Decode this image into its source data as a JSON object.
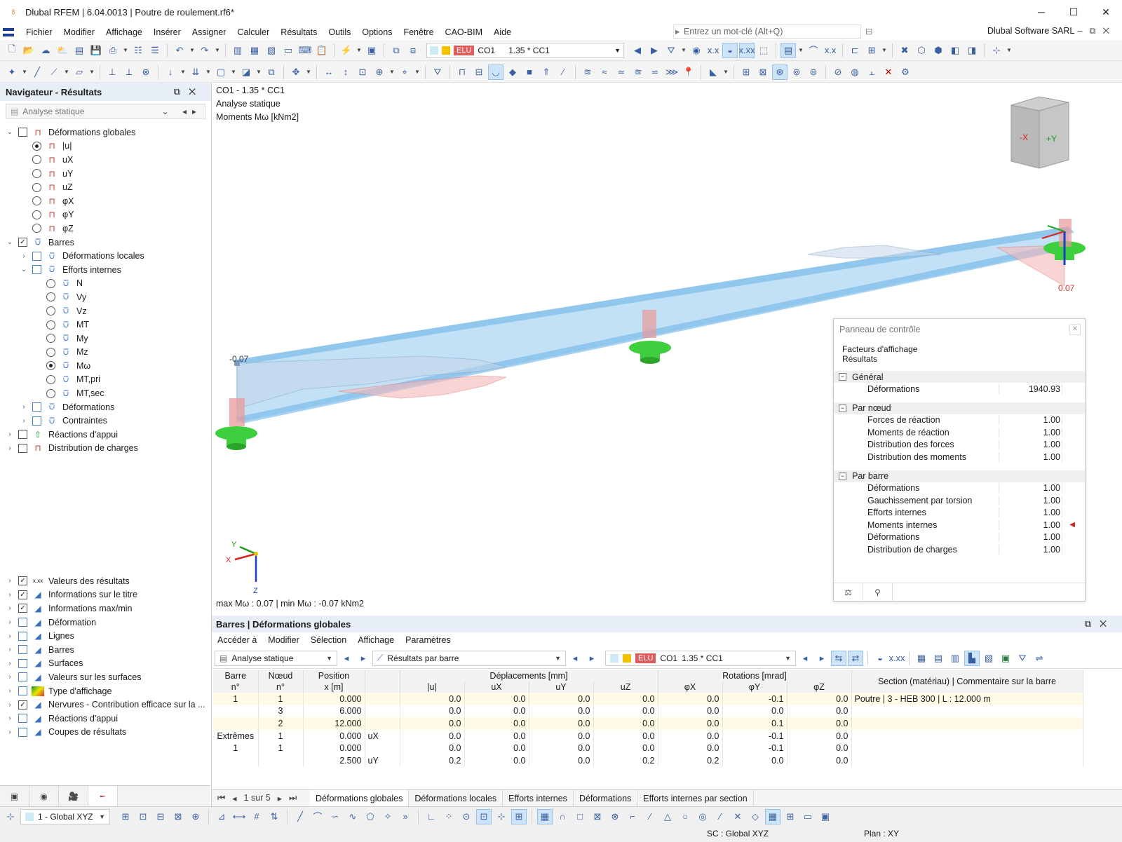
{
  "app": {
    "title": "Dlubal RFEM | 6.04.0013 | Poutre de roulement.rf6*",
    "company": "Dlubal Software SARL"
  },
  "menu": [
    "Fichier",
    "Modifier",
    "Affichage",
    "Insérer",
    "Assigner",
    "Calculer",
    "Résultats",
    "Outils",
    "Options",
    "Fenêtre",
    "CAO-BIM",
    "Aide"
  ],
  "search": {
    "placeholder": "Entrez un mot-clé (Alt+Q)"
  },
  "loadcase": {
    "badge": "ELU",
    "code": "CO1",
    "combo": "1.35 * CC1"
  },
  "navigator": {
    "title": "Navigateur - Résultats",
    "analysis": "Analyse statique",
    "tree": [
      {
        "l": 0,
        "label": "Déformations globales",
        "ex": "v",
        "cb": "off",
        "icon": "frame"
      },
      {
        "l": 1,
        "label": "|u|",
        "rb": "on",
        "icon": "frame"
      },
      {
        "l": 1,
        "label": "uX",
        "rb": "off",
        "icon": "frame"
      },
      {
        "l": 1,
        "label": "uY",
        "rb": "off",
        "icon": "frame"
      },
      {
        "l": 1,
        "label": "uZ",
        "rb": "off",
        "icon": "frame"
      },
      {
        "l": 1,
        "label": "φX",
        "rb": "off",
        "icon": "frame"
      },
      {
        "l": 1,
        "label": "φY",
        "rb": "off",
        "icon": "frame"
      },
      {
        "l": 1,
        "label": "φZ",
        "rb": "off",
        "icon": "frame"
      },
      {
        "l": 0,
        "label": "Barres",
        "ex": "v",
        "cb": "on",
        "icon": "beam"
      },
      {
        "l": 1,
        "label": "Déformations locales",
        "ex": ">",
        "cb": "blue",
        "icon": "beam"
      },
      {
        "l": 1,
        "label": "Efforts internes",
        "ex": "v",
        "cb": "blue",
        "icon": "beam"
      },
      {
        "l": 2,
        "label": "N",
        "rb": "off",
        "icon": "beam"
      },
      {
        "l": 2,
        "label": "Vy",
        "rb": "off",
        "icon": "beam"
      },
      {
        "l": 2,
        "label": "Vz",
        "rb": "off",
        "icon": "beam"
      },
      {
        "l": 2,
        "label": "MT",
        "rb": "off",
        "icon": "beam"
      },
      {
        "l": 2,
        "label": "My",
        "rb": "off",
        "icon": "beam"
      },
      {
        "l": 2,
        "label": "Mz",
        "rb": "off",
        "icon": "beam"
      },
      {
        "l": 2,
        "label": "Mω",
        "rb": "on",
        "icon": "beam"
      },
      {
        "l": 2,
        "label": "MT,pri",
        "rb": "off",
        "icon": "beam"
      },
      {
        "l": 2,
        "label": "MT,sec",
        "rb": "off",
        "icon": "beam"
      },
      {
        "l": 1,
        "label": "Déformations",
        "ex": ">",
        "cb": "blue",
        "icon": "beam"
      },
      {
        "l": 1,
        "label": "Contraintes",
        "ex": ">",
        "cb": "blue",
        "icon": "beam"
      },
      {
        "l": 0,
        "label": "Réactions d'appui",
        "ex": ">",
        "cb": "off",
        "icon": "res"
      },
      {
        "l": 0,
        "label": "Distribution de charges",
        "ex": ">",
        "cb": "off",
        "icon": "frame"
      }
    ],
    "tree2": [
      {
        "label": "Valeurs des résultats",
        "cb": "on",
        "icon": "x.xx"
      },
      {
        "label": "Informations sur le titre",
        "cb": "on",
        "icon": "info"
      },
      {
        "label": "Informations max/min",
        "cb": "on",
        "icon": "info"
      },
      {
        "label": "Déformation",
        "cb": "blue",
        "icon": "info"
      },
      {
        "label": "Lignes",
        "cb": "blue",
        "icon": "info"
      },
      {
        "label": "Barres",
        "cb": "blue",
        "icon": "info"
      },
      {
        "label": "Surfaces",
        "cb": "blue",
        "icon": "info"
      },
      {
        "label": "Valeurs sur les surfaces",
        "cb": "blue",
        "icon": "info"
      },
      {
        "label": "Type d'affichage",
        "cb": "blue",
        "icon": "grad"
      },
      {
        "label": "Nervures - Contribution efficace sur la ...",
        "cb": "on",
        "icon": "info"
      },
      {
        "label": "Réactions d'appui",
        "cb": "blue",
        "icon": "info"
      },
      {
        "label": "Coupes de résultats",
        "cb": "blue",
        "icon": "info"
      }
    ]
  },
  "viewport": {
    "line1": "CO1 - 1.35 * CC1",
    "line2": "Analyse statique",
    "line3": "Moments Mω [kNm2]",
    "maxmin": "max Mω : 0.07 | min Mω : -0.07 kNm2",
    "val_left": "-0.07",
    "val_right": "0.07",
    "axis_x": "X",
    "axis_y": "Y",
    "axis_z": "Z",
    "cube_neg_x": "-X",
    "cube_pos_y": "+Y"
  },
  "control_panel": {
    "title": "Panneau de contrôle",
    "sub1": "Facteurs d'affichage",
    "sub2": "Résultats",
    "sections": [
      {
        "name": "Général",
        "rows": [
          {
            "label": "Déformations",
            "value": "1940.93"
          }
        ]
      },
      {
        "name": "Par nœud",
        "rows": [
          {
            "label": "Forces de réaction",
            "value": "1.00"
          },
          {
            "label": "Moments de réaction",
            "value": "1.00"
          },
          {
            "label": "Distribution des forces",
            "value": "1.00"
          },
          {
            "label": "Distribution des moments",
            "value": "1.00"
          }
        ]
      },
      {
        "name": "Par barre",
        "rows": [
          {
            "label": "Déformations",
            "value": "1.00"
          },
          {
            "label": "Gauchissement par torsion",
            "value": "1.00"
          },
          {
            "label": "Efforts internes",
            "value": "1.00"
          },
          {
            "label": "Moments internes",
            "value": "1.00",
            "marker": true
          },
          {
            "label": "Déformations",
            "value": "1.00"
          },
          {
            "label": "Distribution de charges",
            "value": "1.00"
          }
        ]
      }
    ]
  },
  "results": {
    "title": "Barres | Déformations globales",
    "menu": [
      "Accéder à",
      "Modifier",
      "Sélection",
      "Affichage",
      "Paramètres"
    ],
    "analysis": "Analyse statique",
    "mode": "Résultats par barre",
    "headers": {
      "barre": "Barre",
      "barre2": "n°",
      "noeud": "Nœud",
      "noeud2": "n°",
      "pos": "Position",
      "pos2": "x [m]",
      "dep": "Déplacements [mm]",
      "rot": "Rotations [mrad]",
      "sec": "Section (matériau) | Commentaire sur la barre",
      "u": "|u|",
      "ux": "uX",
      "uy": "uY",
      "uz": "uZ",
      "px": "φX",
      "py": "φY",
      "pz": "φZ"
    },
    "rows": [
      {
        "barre": "1",
        "noeud": "1",
        "x": "0.000",
        "t": "",
        "u": "0.0",
        "ux": "0.0",
        "uy": "0.0",
        "uz": "0.0",
        "px": "0.0",
        "py": "-0.1",
        "pz": "0.0",
        "sec": "Poutre | 3 - HEB 300 | L : 12.000 m",
        "hl": true
      },
      {
        "barre": "",
        "noeud": "3",
        "x": "6.000",
        "t": "",
        "u": "0.0",
        "ux": "0.0",
        "uy": "0.0",
        "uz": "0.0",
        "px": "0.0",
        "py": "0.0",
        "pz": "0.0",
        "sec": ""
      },
      {
        "barre": "",
        "noeud": "2",
        "x": "12.000",
        "t": "",
        "u": "0.0",
        "ux": "0.0",
        "uy": "0.0",
        "uz": "0.0",
        "px": "0.0",
        "py": "0.1",
        "pz": "0.0",
        "sec": "",
        "hl": true
      },
      {
        "barre": "Extrêmes",
        "noeud": "1",
        "x": "0.000",
        "t": "uX",
        "u": "0.0",
        "ux": "0.0",
        "uy": "0.0",
        "uz": "0.0",
        "px": "0.0",
        "py": "-0.1",
        "pz": "0.0",
        "sec": ""
      },
      {
        "barre": "1",
        "noeud": "1",
        "x": "0.000",
        "t": "",
        "u": "0.0",
        "ux": "0.0",
        "uy": "0.0",
        "uz": "0.0",
        "px": "0.0",
        "py": "-0.1",
        "pz": "0.0",
        "sec": ""
      },
      {
        "barre": "",
        "noeud": "",
        "x": "2.500",
        "t": "uY",
        "u": "0.2",
        "ux": "0.0",
        "uy": "0.0",
        "uz": "0.2",
        "px": "0.2",
        "py": "0.0",
        "pz": "0.0",
        "sec": ""
      }
    ],
    "page": "1 sur 5",
    "tabs": [
      "Déformations globales",
      "Déformations locales",
      "Efforts internes",
      "Déformations",
      "Efforts internes par section"
    ]
  },
  "statusbar": {
    "cs": "1 - Global XYZ",
    "sc": "SC : Global XYZ",
    "plan": "Plan : XY"
  }
}
